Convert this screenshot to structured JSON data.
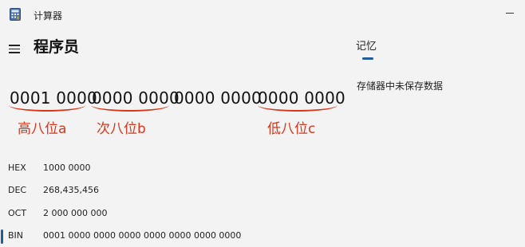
{
  "window": {
    "title": "计算器"
  },
  "header": {
    "mode_title": "程序员"
  },
  "display": {
    "groups": [
      "0001 0000",
      "0000 0000",
      "0000 0000",
      "0000 0000"
    ]
  },
  "annotations": {
    "label_a": "高八位a",
    "label_b": "次八位b",
    "label_c": "低八位c",
    "color": "#d9361b"
  },
  "bases": [
    {
      "label": "HEX",
      "value": "1000 0000"
    },
    {
      "label": "DEC",
      "value": "268,435,456"
    },
    {
      "label": "OCT",
      "value": "2 000 000 000"
    },
    {
      "label": "BIN",
      "value": "0001 0000 0000 0000 0000 0000 0000 0000",
      "selected": true
    }
  ],
  "memory": {
    "tab_label": "记忆",
    "empty_message": "存储器中未保存数据"
  },
  "colors": {
    "accent": "#1f5c99",
    "background": "#f3f3f3"
  }
}
